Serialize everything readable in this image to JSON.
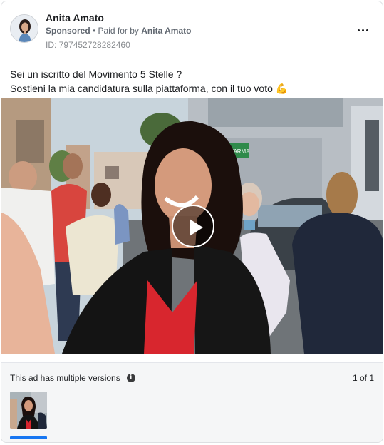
{
  "post": {
    "page_name": "Anita Amato",
    "sponsored": "Sponsored",
    "separator": " • ",
    "paid_prefix": "Paid for by ",
    "paid_by": "Anita Amato",
    "ad_id": "ID: 797452728282460",
    "more_icon": "more-horizontal-icon"
  },
  "message": {
    "line1": "Sei un iscritto del Movimento 5 Stelle ?",
    "line2": "Sostieni la mia candidatura sulla piattaforma, con il tuo voto",
    "emoji": "💪"
  },
  "video": {
    "play_icon": "play-icon",
    "shop_sign": "FARMA"
  },
  "footer": {
    "versions_label": "This ad has multiple versions",
    "info_icon": "i",
    "pagination": "1 of 1"
  },
  "colors": {
    "accent": "#1877f2",
    "dress": "#d8262e"
  }
}
